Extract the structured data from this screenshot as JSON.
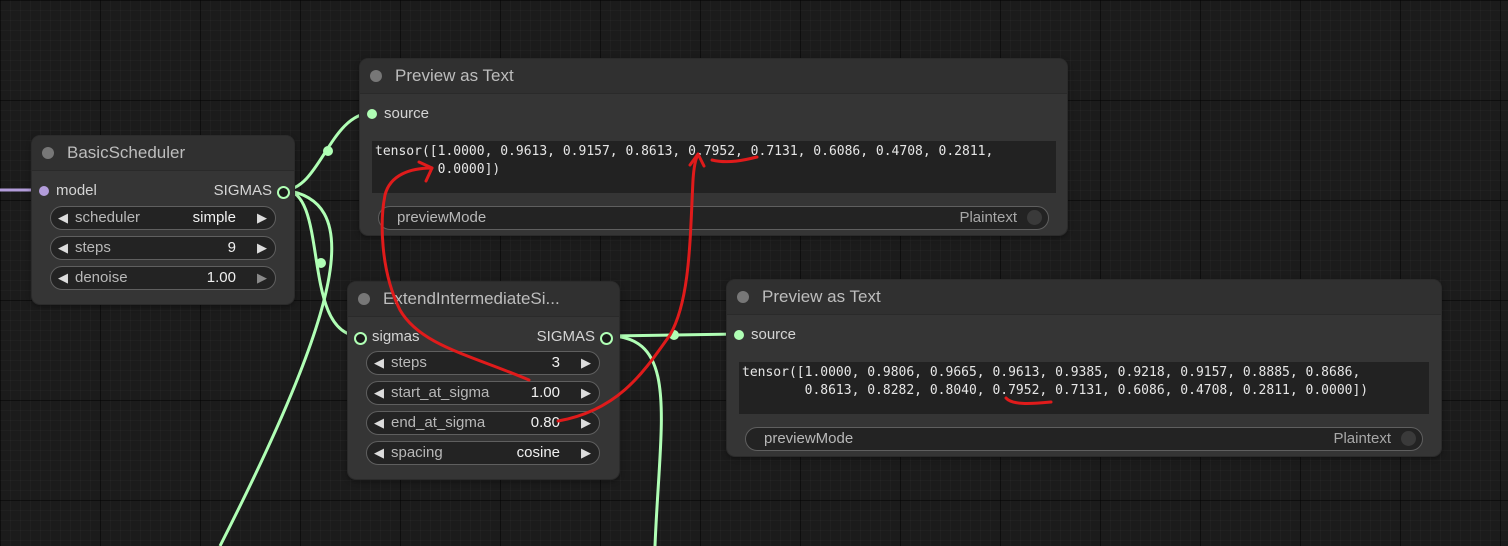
{
  "colors": {
    "link_sigmas": "#b0ffb5",
    "link_model": "#b39ddb",
    "annotation": "#e01b1b",
    "node_bg": "#353535"
  },
  "basic_scheduler": {
    "title": "BasicScheduler",
    "input_label": "model",
    "output_label": "SIGMAS",
    "widgets": [
      {
        "name": "scheduler",
        "value": "simple"
      },
      {
        "name": "steps",
        "value": "9"
      },
      {
        "name": "denoise",
        "value": "1.00"
      }
    ]
  },
  "preview_text_1": {
    "title": "Preview as Text",
    "input_label": "source",
    "text_line_1": "tensor([1.0000, 0.9613, 0.9157, 0.8613, 0.7952, 0.7131, 0.6086, 0.4708, 0.2811,",
    "text_line_2": "        0.0000])",
    "mode_label": "previewMode",
    "mode_value": "Plaintext"
  },
  "extend_intermediate": {
    "title": "ExtendIntermediateSi...",
    "input_label": "sigmas",
    "output_label": "SIGMAS",
    "widgets": [
      {
        "name": "steps",
        "value": "3"
      },
      {
        "name": "start_at_sigma",
        "value": "1.00"
      },
      {
        "name": "end_at_sigma",
        "value": "0.80"
      },
      {
        "name": "spacing",
        "value": "cosine"
      }
    ]
  },
  "preview_text_2": {
    "title": "Preview as Text",
    "input_label": "source",
    "text_line_1": "tensor([1.0000, 0.9806, 0.9665, 0.9613, 0.9385, 0.9218, 0.9157, 0.8885, 0.8686,",
    "text_line_2": "        0.8613, 0.8282, 0.8040, 0.7952, 0.7131, 0.6086, 0.4708, 0.2811, 0.0000])",
    "mode_label": "previewMode",
    "mode_value": "Plaintext"
  }
}
